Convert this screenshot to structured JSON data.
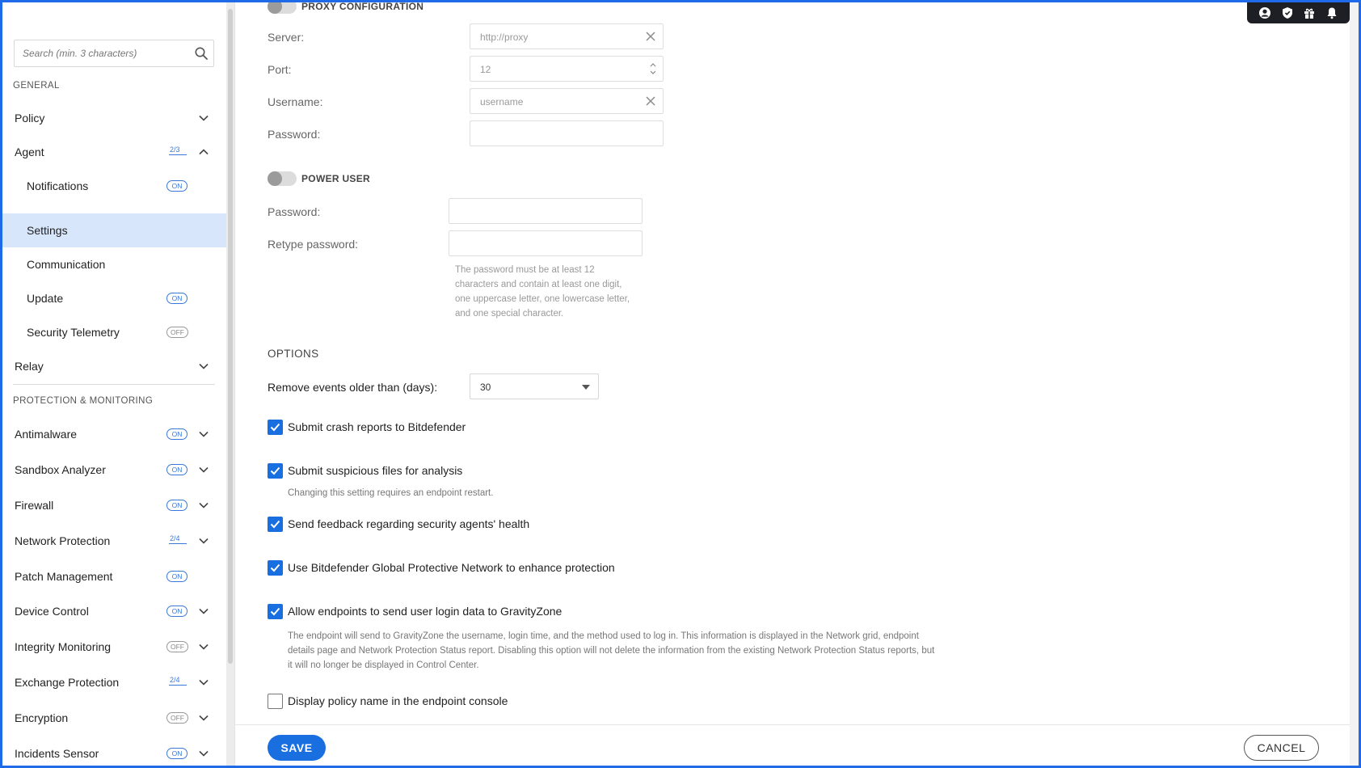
{
  "sidebar": {
    "search_placeholder": "Search (min. 3 characters)",
    "section_general": "GENERAL",
    "section_protection": "PROTECTION & MONITORING",
    "items": [
      {
        "label": "Policy"
      },
      {
        "label": "Agent",
        "fraction": "2/3"
      },
      {
        "label": "Notifications",
        "badge": "ON"
      },
      {
        "label": "Settings"
      },
      {
        "label": "Communication"
      },
      {
        "label": "Update",
        "badge": "ON"
      },
      {
        "label": "Security Telemetry",
        "badge": "OFF"
      },
      {
        "label": "Relay"
      },
      {
        "label": "Antimalware",
        "badge": "ON"
      },
      {
        "label": "Sandbox Analyzer",
        "badge": "ON"
      },
      {
        "label": "Firewall",
        "badge": "ON"
      },
      {
        "label": "Network Protection",
        "fraction": "2/4"
      },
      {
        "label": "Patch Management",
        "badge": "ON"
      },
      {
        "label": "Device Control",
        "badge": "ON"
      },
      {
        "label": "Integrity Monitoring",
        "badge": "OFF"
      },
      {
        "label": "Exchange Protection",
        "fraction": "2/4"
      },
      {
        "label": "Encryption",
        "badge": "OFF"
      },
      {
        "label": "Incidents Sensor",
        "badge": "ON"
      }
    ]
  },
  "proxy": {
    "title": "PROXY CONFIGURATION",
    "server_label": "Server:",
    "server_value": "http://proxy",
    "port_label": "Port:",
    "port_value": "12",
    "username_label": "Username:",
    "username_value": "username",
    "password_label": "Password:"
  },
  "power_user": {
    "title": "POWER USER",
    "password_label": "Password:",
    "retype_label": "Retype password:",
    "hint_lines": [
      "The password must be at least 12",
      "characters and contain at least one digit,",
      "one uppercase letter, one lowercase letter,",
      "and one special character."
    ]
  },
  "options": {
    "title": "OPTIONS",
    "remove_events_label": "Remove events older than (days):",
    "remove_events_value": "30",
    "checkboxes": [
      {
        "label": "Submit crash reports to Bitdefender",
        "checked": true
      },
      {
        "label": "Submit suspicious files for analysis",
        "checked": true
      },
      {
        "label": "Send feedback regarding security agents' health",
        "checked": true
      },
      {
        "label": "Use Bitdefender Global Protective Network to enhance protection",
        "checked": true
      },
      {
        "label": "Allow endpoints to send user login data to GravityZone",
        "checked": true
      },
      {
        "label": "Display policy name in the endpoint console",
        "checked": false
      }
    ],
    "restart_note": "Changing this setting requires an endpoint restart.",
    "login_note_lines": [
      "The endpoint will send to GravityZone the username, login time, and the method used to log in. This information is displayed in the Network grid, endpoint",
      "details page and Network Protection Status report. Disabling this option will not delete the information from the existing Network Protection Status reports, but",
      "it will no longer be displayed in Control Center."
    ]
  },
  "footer": {
    "save_label": "SAVE",
    "cancel_label": "CANCEL"
  },
  "tray_icons": [
    "user-icon",
    "shield-icon",
    "gift-icon",
    "bell-icon"
  ],
  "colors": {
    "accent": "#1a6fe0",
    "frame": "#1e6ae8",
    "active_row": "#d7e6fb"
  }
}
